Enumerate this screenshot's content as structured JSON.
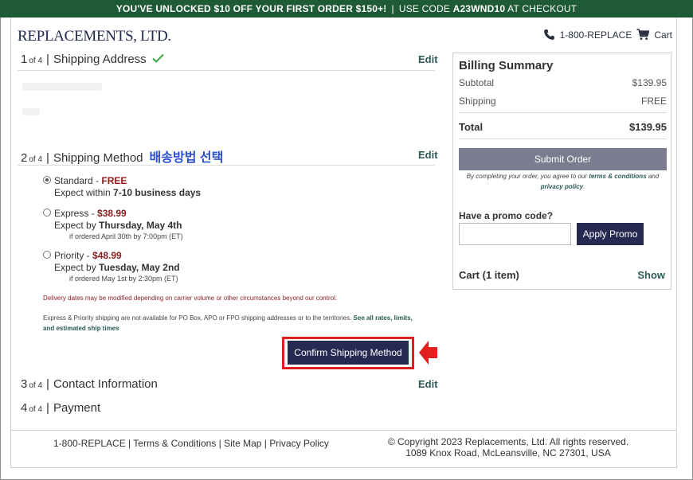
{
  "promo_bar": {
    "offer": "YOU'VE UNLOCKED $10 OFF YOUR FIRST ORDER $150+!",
    "separator": "|",
    "code_prefix": "USE CODE",
    "code": "A23WND10",
    "code_suffix": "AT CHECKOUT",
    "background": "#1f5a37"
  },
  "header": {
    "logo": "REPLACEMENTS, LTD.",
    "phone": "1-800-REPLACE",
    "cart": "Cart"
  },
  "steps": [
    {
      "num": "1",
      "of": "of 4",
      "divider": "|",
      "title": "Shipping Address",
      "edit": "Edit"
    },
    {
      "num": "2",
      "of": "of 4",
      "divider": "|",
      "title": "Shipping Method",
      "annotation": "배송방법 선택",
      "edit": "Edit"
    },
    {
      "num": "3",
      "of": "of 4",
      "divider": "|",
      "title": "Contact Information",
      "edit": "Edit"
    },
    {
      "num": "4",
      "of": "of 4",
      "divider": "|",
      "title": "Payment"
    }
  ],
  "shipping_options": [
    {
      "name": "Standard",
      "dash": " - ",
      "price": "FREE",
      "line2_prefix": "Expect within ",
      "line2_strong": "7-10 business days",
      "line3": "",
      "selected": true
    },
    {
      "name": "Express",
      "dash": " - ",
      "price": "$38.99",
      "line2_prefix": "Expect by ",
      "line2_strong": "Thursday, May 4th",
      "line3": "if ordered April 30th by 7:00pm (ET)",
      "selected": false
    },
    {
      "name": "Priority",
      "dash": " - ",
      "price": "$48.99",
      "line2_prefix": "Expect by ",
      "line2_strong": "Tuesday, May 2nd",
      "line3": "if ordered May 1st by 2:30pm (ET)",
      "selected": false
    }
  ],
  "notices": {
    "delivery": "Delivery dates may be modified depending on carrier volume or other circumstances beyond our control.",
    "restriction": "Express & Priority shipping are not available for PO Box, APO or FPO shipping addresses or to the territories.",
    "restriction_link": "See all rates, limits, and estimated ship times"
  },
  "confirm_button": "Confirm Shipping Method",
  "billing": {
    "title": "Billing Summary",
    "subtotal_label": "Subtotal",
    "subtotal_value": "$139.95",
    "shipping_label": "Shipping",
    "shipping_value": "FREE",
    "total_label": "Total",
    "total_value": "$139.95",
    "submit": "Submit Order",
    "agree_prefix": "By completing your order, you agree to our",
    "agree_terms": "terms & conditions",
    "agree_and": "and",
    "agree_privacy": "privacy policy",
    "agree_end": ".",
    "promo_label": "Have a promo code?",
    "promo_value": "",
    "promo_button": "Apply Promo",
    "cart_label": "Cart (1 item)",
    "cart_show": "Show"
  },
  "footer": {
    "links": "1-800-REPLACE | Terms & Conditions | Site Map | Privacy Policy",
    "copyright": "© Copyright 2023 Replacements, Ltd. All rights reserved.",
    "address": "1089 Knox Road, McLeansville, NC 27301, USA"
  },
  "colors": {
    "brand_navy": "#262a52",
    "link_green": "#2a5b55",
    "price_red": "#8a1c1c",
    "highlight_red": "#e01f1f",
    "annotation_blue": "#2a4fcf"
  }
}
